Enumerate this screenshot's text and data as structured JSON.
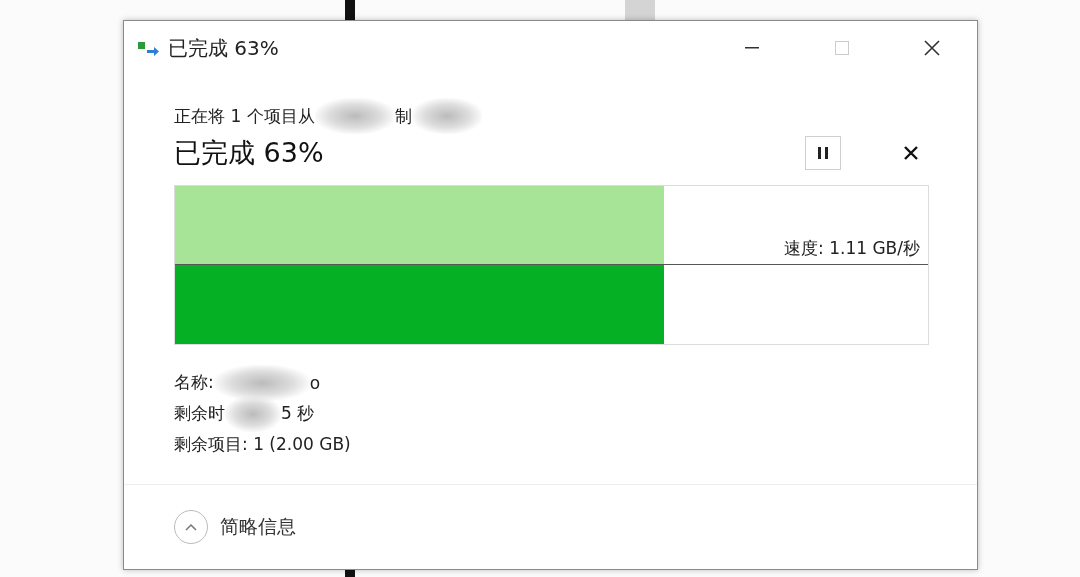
{
  "window": {
    "title": "已完成 63%",
    "maximize_disabled": true
  },
  "status": {
    "from_text": "正在将 1 个项目从",
    "from_tail": "制",
    "headline": "已完成 63%",
    "paused": false
  },
  "progress": {
    "level": 0.65,
    "speed": "速度: 1.11 GB/秒"
  },
  "details": [
    {
      "kind": "name",
      "label": "名称:",
      "tail": "o"
    },
    {
      "kind": "split",
      "head": "剩余时",
      "tail": "5 秒"
    },
    {
      "kind": "plain",
      "text": "剩余项目: 1 (2.00 GB)"
    }
  ],
  "footer": {
    "label": "简略信息",
    "expanded": true
  }
}
